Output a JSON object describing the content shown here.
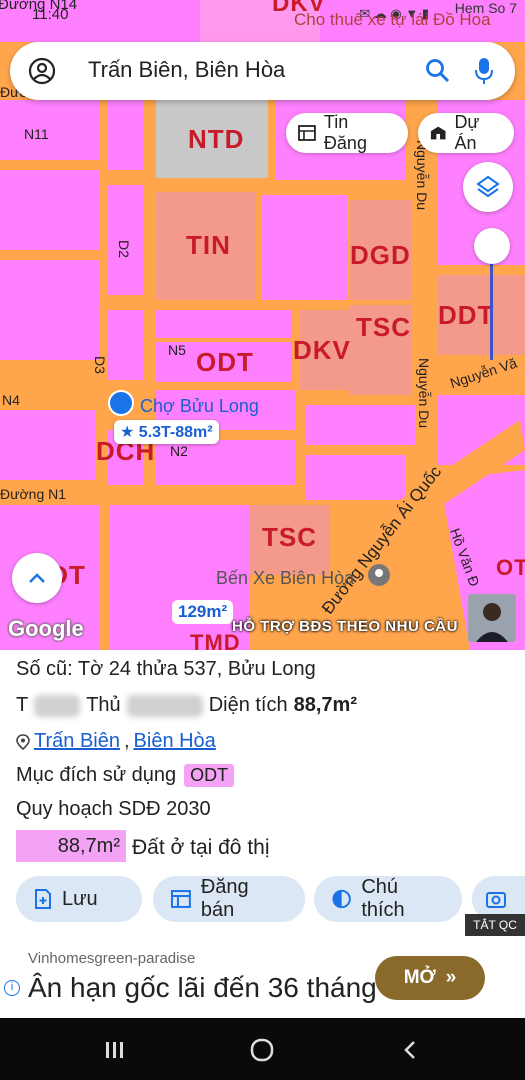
{
  "status": {
    "time": "11:40",
    "carrier": "Hem So 7"
  },
  "map_overlay_top": {
    "road_n14": "Đường N14",
    "dkv_top": "DKV",
    "rent_sign": "Cho thuê xe tự lái Đồ Hoa"
  },
  "search": {
    "query": "Trấn Biên, Biên Hòa"
  },
  "chips": {
    "listing": "Tin Đăng",
    "project": "Dự Án"
  },
  "zones": [
    {
      "code": "NTD"
    },
    {
      "code": "TIN"
    },
    {
      "code": "DGD"
    },
    {
      "code": "TSC"
    },
    {
      "code": "DDT"
    },
    {
      "code": "ODT"
    },
    {
      "code": "DKV"
    },
    {
      "code": "DCH"
    },
    {
      "code": "TSC"
    },
    {
      "code": "ODT"
    },
    {
      "code": "TMD"
    },
    {
      "code": "OT"
    }
  ],
  "roads": {
    "n11": "N11",
    "d2": "D2",
    "n5": "N5",
    "d3": "D3",
    "n4": "N4",
    "n2": "N2",
    "n1": "Đường N1",
    "nguyen_du_1": "Nguyễn Du",
    "nguyen_du_2": "Nguyễn Du",
    "nguyen_van": "Nguyễn Vă",
    "nguyen_ai_quoc": "Đường Nguyễn Ái Quốc",
    "ho_van": "Hồ Văn Đ",
    "duong_left": "Đườ"
  },
  "poi": {
    "market": "Chợ Bửu Long",
    "bus": "Bến Xe Biên Hòa"
  },
  "price_tag": "★ 5.3T-88m²",
  "area_tag": "129m²",
  "promo": "HỖ TRỢ BĐS  THEO NHU CẦU",
  "google": "Google",
  "panel": {
    "old_parcel": "Số cũ: Tờ 24 thửa 537, Bửu Long",
    "owner_prefix": "T",
    "owner_mid": "Thủ",
    "area_label": "Diện tích",
    "area_value": "88,7m²",
    "location_1": "Trấn Biên",
    "location_sep": ",",
    "location_2": "Biên Hòa",
    "purpose_label": "Mục đích sử dụng",
    "purpose_code": "ODT",
    "plan": "Quy hoạch SDĐ 2030",
    "area_pill": "88,7m²",
    "area_desc": "Đất ở tại đô thị"
  },
  "buttons": {
    "save": "Lưu",
    "sell": "Đăng bán",
    "legend": "Chú thích"
  },
  "tatqc": "TẮT QC",
  "ad": {
    "source": "Vinhomesgreen-paradise",
    "title": "Ân hạn gốc lãi đến 36 tháng",
    "cta": "MỞ"
  },
  "colors": {
    "residential": "#ff80ff",
    "road": "#ffa64d",
    "zone_text": "#c81a2a",
    "accent": "#1a73e8",
    "ad_button": "#8a6a2b"
  }
}
